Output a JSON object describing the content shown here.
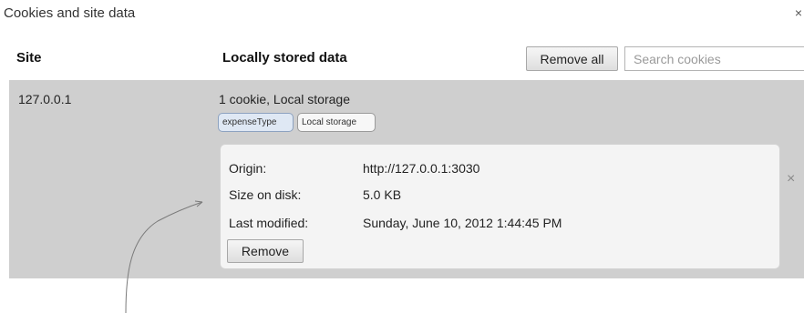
{
  "dialog": {
    "title": "Cookies and site data",
    "close_glyph": "×"
  },
  "columns": {
    "site": "Site",
    "data": "Locally stored data"
  },
  "toolbar": {
    "remove_all_label": "Remove all",
    "search_placeholder": "Search cookies",
    "search_value": ""
  },
  "site": {
    "name": "127.0.0.1",
    "summary": "1 cookie, Local storage",
    "chips": [
      {
        "label": "expenseType",
        "selected": true
      },
      {
        "label": "Local storage",
        "selected": false
      }
    ],
    "details": {
      "origin_label": "Origin:",
      "origin_value": "http://127.0.0.1:3030",
      "size_label": "Size on disk:",
      "size_value": "5.0 KB",
      "modified_label": "Last modified:",
      "modified_value": "Sunday, June 10, 2012 1:44:45 PM",
      "remove_label": "Remove"
    },
    "row_remove_glyph": "×"
  },
  "colors": {
    "row_bg": "#cfcfcf",
    "detail_bg": "#f4f4f4",
    "chip_selected_bg": "#dfe8f4"
  }
}
